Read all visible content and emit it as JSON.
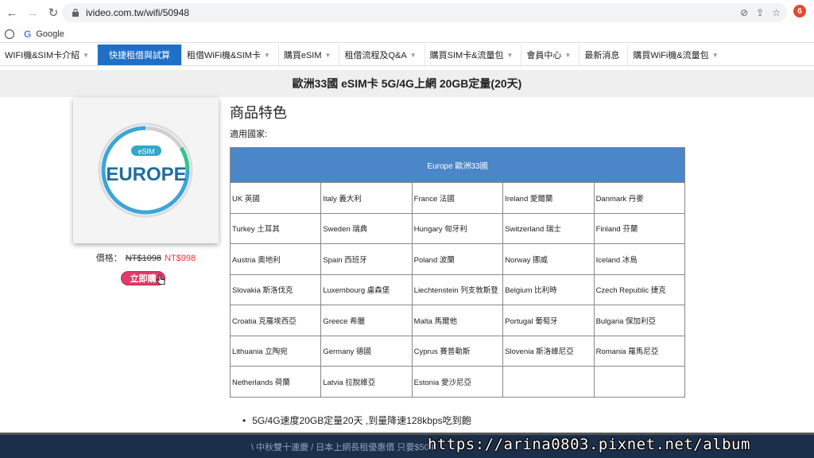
{
  "browser": {
    "url": "ivideo.com.tw/wifi/50948",
    "bookmark_label": "Google",
    "ext_badge": "6"
  },
  "nav": {
    "items": [
      {
        "label": "WIFI機&SIM卡介紹"
      },
      {
        "label": "快捷租借與試算"
      },
      {
        "label": "租借WiFi機&SIM卡"
      },
      {
        "label": "購買eSIM"
      },
      {
        "label": "租借流程及Q&A"
      },
      {
        "label": "購買SIM卡&流量包"
      },
      {
        "label": "會員中心"
      },
      {
        "label": "最新消息"
      },
      {
        "label": "購買WiFi機&流量包"
      }
    ]
  },
  "product": {
    "title": "歐洲33國 eSIM卡 5G/4G上網 20GB定量(20天)",
    "badge_small": "eSIM",
    "badge_large": "EUROPE",
    "price_label": "價格：",
    "old_price": "NT$1098",
    "new_price": "NT$998",
    "buy_label": "立即購"
  },
  "features": {
    "heading": "商品特色",
    "countries_label": "適用國家:",
    "table_header": "Europe 歐洲33國",
    "rows": [
      [
        "UK 英國",
        "Italy 義大利",
        "France 法國",
        "Ireland 愛爾蘭",
        "Danmark 丹麥"
      ],
      [
        "Turkey 土耳其",
        "Sweden 瑞典",
        "Hungary 匈牙利",
        "Switzerland 瑞士",
        "Finland 芬蘭"
      ],
      [
        "Austria 奧地利",
        "Spain 西班牙",
        "Poland 波蘭",
        "Norway 挪威",
        "Iceland 冰島"
      ],
      [
        "Slovakia 斯洛伐克",
        "Luxembourg 盧森堡",
        "Liechtenstein 列支敦斯登",
        "Belgium 比利時",
        "Czech Republic 捷克"
      ],
      [
        "Croatia 克羅埃西亞",
        "Greece 希臘",
        "Malta 馬爾他",
        "Portugal 葡萄牙",
        "Bulgaria 保加利亞"
      ],
      [
        "Lithuania 立陶宛",
        "Germany 德國",
        "Cyprus 賽普勒斯",
        "Slovenia 斯洛維尼亞",
        "Romania 羅馬尼亞"
      ],
      [
        "Netherlands 荷蘭",
        "Latvia 拉脫維亞",
        "Estonia 愛沙尼亞",
        "",
        ""
      ]
    ],
    "bullet": "5G/4G速度20GB定量20天 ,到量降速128kbps吃到飽"
  },
  "footer": {
    "ticker": "\\ 中秋雙十連慶 / 日本上網長租優惠價 只要$509",
    "watermark": "https://arina0803.pixnet.net/album"
  }
}
